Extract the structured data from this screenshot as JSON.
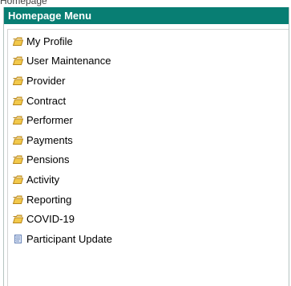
{
  "header": {
    "top_text": "Homepage",
    "title": "Homepage Menu"
  },
  "menu": {
    "items": [
      {
        "label": "My Profile",
        "icon": "folder-icon"
      },
      {
        "label": "User Maintenance",
        "icon": "folder-icon"
      },
      {
        "label": "Provider",
        "icon": "folder-icon"
      },
      {
        "label": "Contract",
        "icon": "folder-icon"
      },
      {
        "label": "Performer",
        "icon": "folder-icon"
      },
      {
        "label": "Payments",
        "icon": "folder-icon"
      },
      {
        "label": "Pensions",
        "icon": "folder-icon"
      },
      {
        "label": "Activity",
        "icon": "folder-icon"
      },
      {
        "label": "Reporting",
        "icon": "folder-icon"
      },
      {
        "label": "COVID-19",
        "icon": "folder-icon"
      },
      {
        "label": "Participant Update",
        "icon": "document-icon"
      }
    ]
  },
  "colors": {
    "header_bg": "#087e73",
    "header_text": "#ffffff",
    "folder": "#f2c94c",
    "border": "#b5c4c1"
  }
}
